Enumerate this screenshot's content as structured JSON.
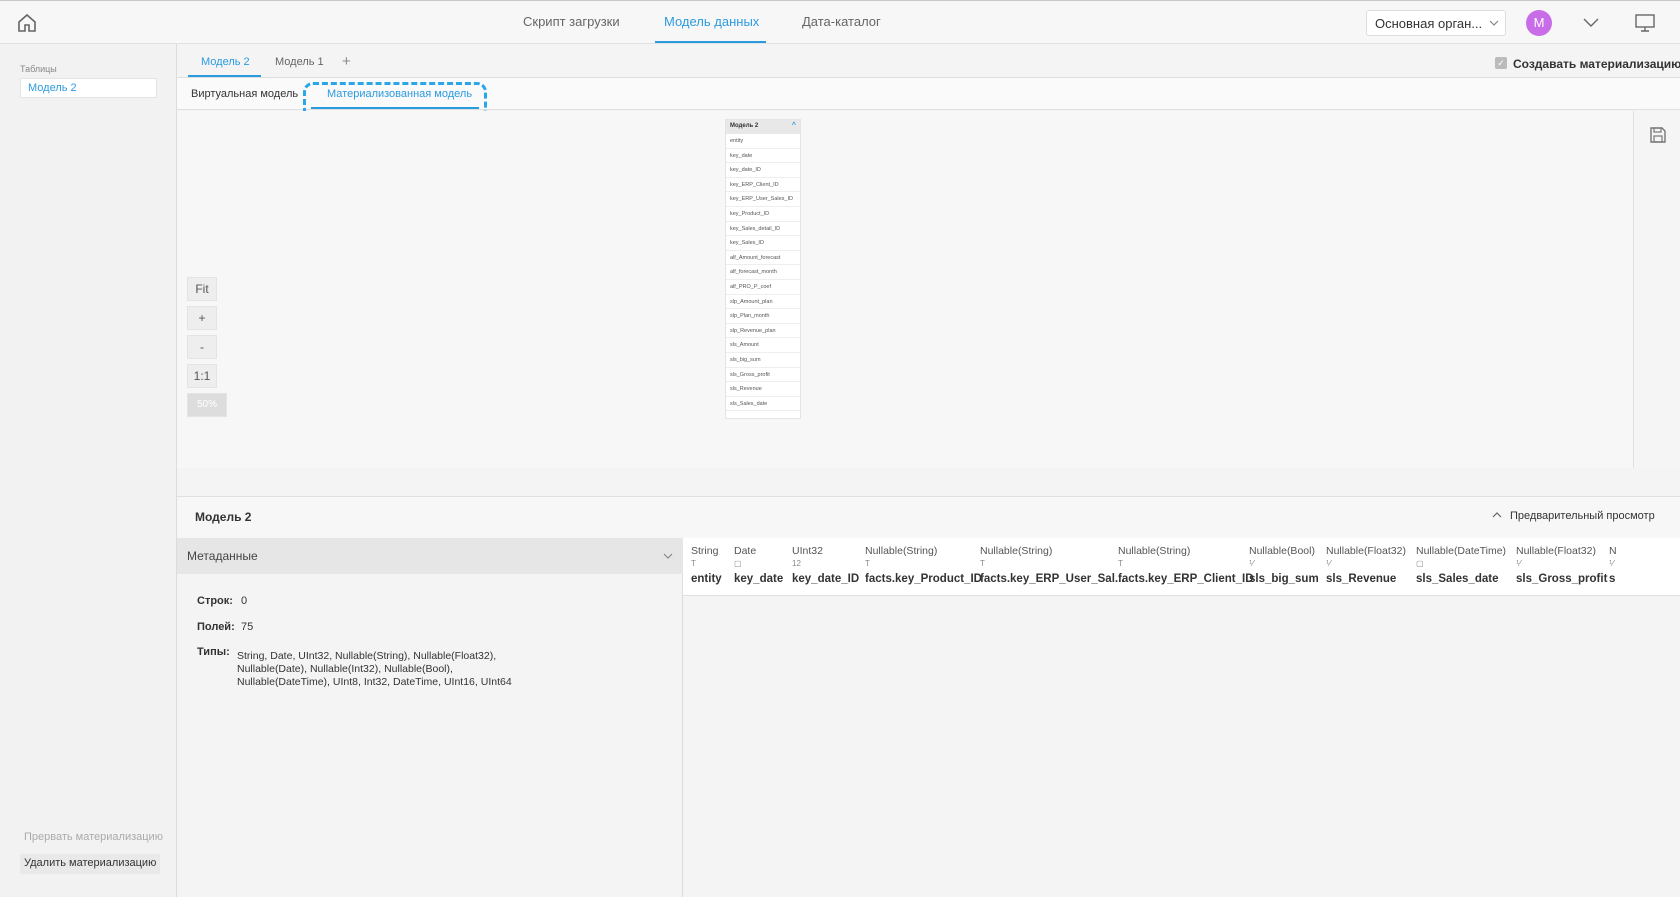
{
  "nav": {
    "items": [
      "Скрипт загрузки",
      "Модель данных",
      "Дата-каталог"
    ],
    "active": "Модель данных"
  },
  "org": {
    "value": "Основная орган..."
  },
  "avatar": {
    "letter": "M",
    "color": "#c86ce8"
  },
  "accent": "#2b9be0",
  "sidebar": {
    "section_label": "Таблицы",
    "items": [
      "Модель 2"
    ],
    "interrupt_label": "Прервать материализацию",
    "delete_label": "Удалить материализацию"
  },
  "model_tabs": {
    "items": [
      "Модель 2",
      "Модель 1"
    ],
    "add": "+"
  },
  "create_mat": {
    "label": "Создавать материализацию",
    "checked": true
  },
  "view_tabs": {
    "virtual": "Виртуальная модель",
    "materialized": "Материализованная модель"
  },
  "zoom": {
    "fit": "Fit",
    "plus": "+",
    "minus": "-",
    "one": "1:1",
    "percent": "50%"
  },
  "minicard": {
    "title": "Модель 2",
    "fields": [
      "entity",
      "key_date",
      "key_date_ID",
      "key_ERP_Client_ID",
      "key_ERP_User_Sales_ID",
      "key_Product_ID",
      "key_Sales_detail_ID",
      "key_Sales_ID",
      "alf_Amount_forecast",
      "alf_forecast_month",
      "alf_PRO_P_coef",
      "slp_Amount_plan",
      "slp_Plan_month",
      "slp_Revenue_plan",
      "sls_Amount",
      "sls_big_sum",
      "sls_Gross_profit",
      "sls_Revenue",
      "sls_Sales_date"
    ]
  },
  "bottom": {
    "title": "Модель 2",
    "preview_label": "Предварительный просмотр",
    "meta_header": "Метаданные",
    "rows_label": "Строк:",
    "rows_value": "0",
    "fields_label": "Полей:",
    "fields_value": "75",
    "types_label": "Типы:",
    "types_value": "String, Date, UInt32, Nullable(String), Nullable(Float32), Nullable(Date), Nullable(Int32), Nullable(Bool), Nullable(DateTime), UInt8, Int32, DateTime, UInt16, UInt64"
  },
  "columns": [
    {
      "type": "String",
      "icon": "T",
      "name": "entity"
    },
    {
      "type": "Date",
      "icon": "▢",
      "name": "key_date"
    },
    {
      "type": "UInt32",
      "icon": "12",
      "name": "key_date_ID"
    },
    {
      "type": "Nullable(String)",
      "icon": "T",
      "name": "facts.key_Product_ID"
    },
    {
      "type": "Nullable(String)",
      "icon": "T",
      "name": "facts.key_ERP_User_Sal..."
    },
    {
      "type": "Nullable(String)",
      "icon": "T",
      "name": "facts.key_ERP_Client_ID"
    },
    {
      "type": "Nullable(Bool)",
      "icon": "⅟",
      "name": "sls_big_sum"
    },
    {
      "type": "Nullable(Float32)",
      "icon": "⅟",
      "name": "sls_Revenue"
    },
    {
      "type": "Nullable(DateTime)",
      "icon": "▢",
      "name": "sls_Sales_date"
    },
    {
      "type": "Nullable(Float32)",
      "icon": "⅟",
      "name": "sls_Gross_profit"
    },
    {
      "type": "N",
      "icon": "⅟",
      "name": "s"
    }
  ]
}
